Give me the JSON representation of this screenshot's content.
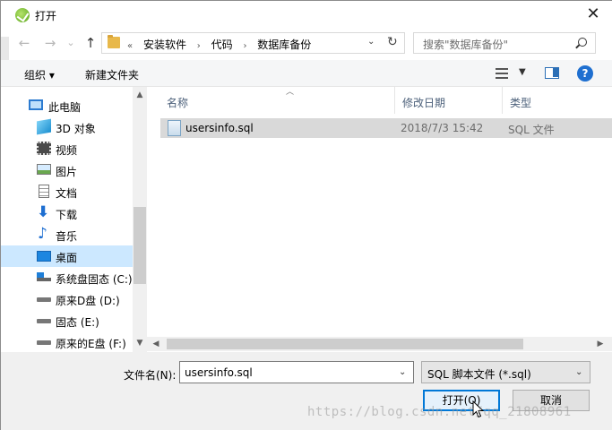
{
  "window": {
    "title": "打开",
    "close_glyph": "✕"
  },
  "nav": {
    "back_glyph": "←",
    "forward_glyph": "→",
    "recent_glyph": "⌄",
    "up_glyph": "↑",
    "breadcrumb_prefix": "«",
    "breadcrumbs": [
      "安装软件",
      "代码",
      "数据库备份"
    ],
    "breadcrumb_sep": "›",
    "search_placeholder": "搜索\"数据库备份\""
  },
  "toolbar": {
    "organize_label": "组织 ▾",
    "new_folder_label": "新建文件夹"
  },
  "sidebar": {
    "items": [
      {
        "label": "此电脑",
        "icon": "computer-icon"
      },
      {
        "label": "3D 对象",
        "icon": "cube-icon"
      },
      {
        "label": "视频",
        "icon": "video-icon"
      },
      {
        "label": "图片",
        "icon": "picture-icon"
      },
      {
        "label": "文档",
        "icon": "document-icon"
      },
      {
        "label": "下载",
        "icon": "download-icon"
      },
      {
        "label": "音乐",
        "icon": "music-icon"
      },
      {
        "label": "桌面",
        "icon": "desktop-icon",
        "selected": true
      },
      {
        "label": "系统盘固态 (C:)",
        "icon": "system-drive-icon"
      },
      {
        "label": "原来D盘 (D:)",
        "icon": "drive-icon"
      },
      {
        "label": "固态 (E:)",
        "icon": "drive-icon"
      },
      {
        "label": "原来的E盘 (F:)",
        "icon": "drive-icon"
      }
    ]
  },
  "columns": {
    "name": "名称",
    "modified": "修改日期",
    "type": "类型"
  },
  "files": [
    {
      "name": "usersinfo.sql",
      "modified": "2018/7/3 15:42",
      "type": "SQL 文件"
    }
  ],
  "footer": {
    "filename_label": "文件名(N):",
    "filename_value": "usersinfo.sql",
    "filetype_value": "SQL 脚本文件 (*.sql)",
    "open_label": "打开(O)",
    "cancel_label": "取消"
  },
  "watermark": "https://blog.csdn.net/qq_21808961",
  "colors": {
    "selection": "#cce8ff",
    "accent": "#0078d7",
    "row_selected": "#d9d9d9"
  }
}
